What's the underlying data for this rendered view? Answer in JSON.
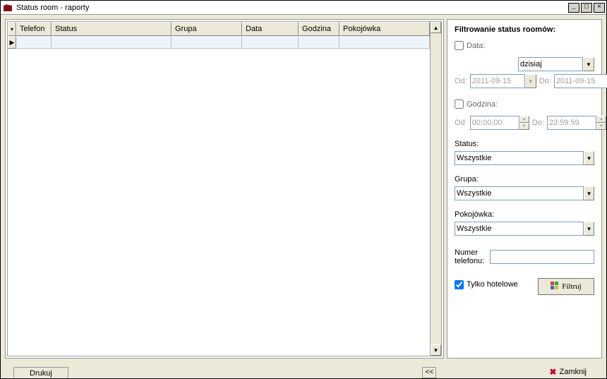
{
  "window": {
    "title": "Status room - raporty"
  },
  "grid": {
    "columns": [
      "Telefon",
      "Status",
      "Grupa",
      "Data",
      "Godzina",
      "Pokojówka"
    ]
  },
  "filter": {
    "heading": "Filtrowanie status roomów:",
    "data_label": "Data:",
    "data_preset": "dzisiaj",
    "od_label": "Od:",
    "do_label": "Do:",
    "date_from": "2011-09-15",
    "date_to": "2011-09-15",
    "godzina_label": "Godzina:",
    "time_from": "00:00:00",
    "time_to": "23:59:59",
    "status_label": "Status:",
    "status_value": "Wszystkie",
    "grupa_label": "Grupa:",
    "grupa_value": "Wszystkie",
    "pokojowka_label": "Pokojówka:",
    "pokojowka_value": "Wszystkie",
    "phone_label": "Numer telefonu:",
    "hotel_label": "Tylko hotelowe",
    "filter_btn": "Filtruj"
  },
  "footer": {
    "print": "Drukuj",
    "collapse": "<<",
    "close": "Zamknij"
  }
}
